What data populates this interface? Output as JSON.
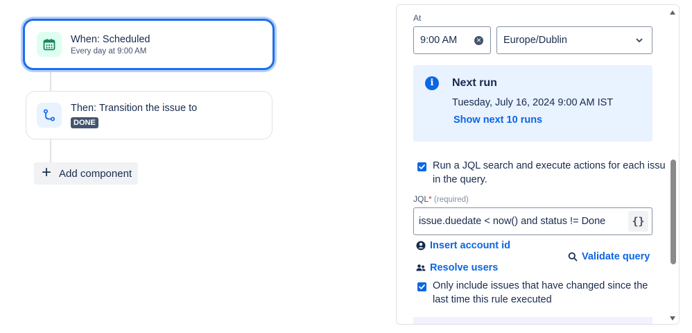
{
  "flow": {
    "trigger": {
      "title": "When: Scheduled",
      "subtitle": "Every day at 9:00 AM",
      "icon": "calendar-icon"
    },
    "action": {
      "title": "Then: Transition the issue to",
      "status": "DONE",
      "icon": "transition-icon"
    },
    "add_component_label": "Add component"
  },
  "panel": {
    "at_label": "At",
    "time_value": "9:00 AM",
    "timezone_value": "Europe/Dublin",
    "next_run": {
      "title": "Next run",
      "date": "Tuesday, July 16, 2024 9:00 AM IST",
      "show_more_label": "Show next 10 runs"
    },
    "run_jql": {
      "checked": true,
      "label_line1": "Run a JQL search and execute actions for each issue",
      "label_line2": "in the query."
    },
    "jql": {
      "label": "JQL",
      "required_mark": "*",
      "required_hint": "(required)",
      "value": "issue.duedate < now() and status != Done",
      "braces_label": "{}"
    },
    "insert_account_id_label": "Insert account id",
    "validate_query_label": "Validate query",
    "resolve_users_label": "Resolve users",
    "only_changed": {
      "checked": true,
      "label_line1": "Only include issues that have changed since the",
      "label_line2": "last time this rule executed"
    }
  },
  "colors": {
    "accent": "#0c66e4",
    "selected_border": "#1d6ee8",
    "info_bg": "#e9f2ff",
    "lozenge_bg": "#44546f",
    "trigger_icon_bg": "#dcfff1"
  }
}
